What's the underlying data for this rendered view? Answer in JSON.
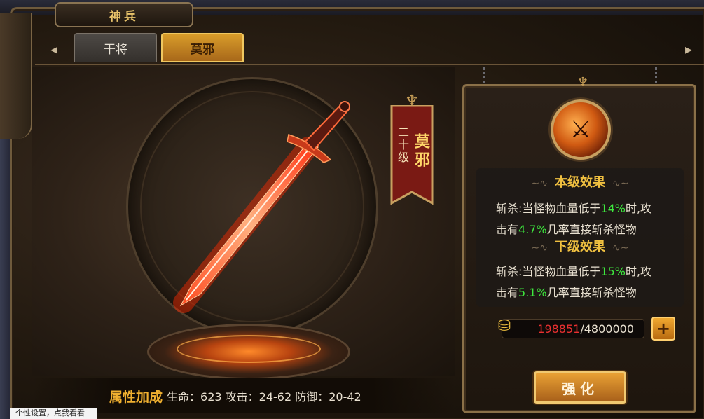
{
  "window": {
    "title": "神兵"
  },
  "tabs": [
    {
      "label": "干将",
      "active": false
    },
    {
      "label": "莫邪",
      "active": true
    }
  ],
  "weapon": {
    "level_text": "二十级",
    "name": "莫邪"
  },
  "attributes": {
    "title": "属性加成",
    "values_text": "生命：623 攻击：24-62 防御：20-42"
  },
  "current_effect": {
    "title": "本级效果",
    "line1_prefix": "斩杀:当怪物血量低于",
    "line1_value": "14%",
    "line1_suffix": "时,攻",
    "line2_prefix": "击有",
    "line2_value": "4.7%",
    "line2_suffix": "几率直接斩杀怪物"
  },
  "next_effect": {
    "title": "下级效果",
    "line1_prefix": "斩杀:当怪物血量低于",
    "line1_value": "15%",
    "line1_suffix": "时,攻",
    "line2_prefix": "击有",
    "line2_value": "5.1%",
    "line2_suffix": "几率直接斩杀怪物"
  },
  "cost": {
    "current": "198851",
    "separator": "/",
    "required": "4800000"
  },
  "buttons": {
    "plus": "+",
    "upgrade": "强化"
  },
  "icons": {
    "nav_left": "◂",
    "nav_right": "▸",
    "crest": "♆",
    "coin": "⛁",
    "skill": "⚔"
  },
  "tooltip": {
    "text": "个性设置，点我看看"
  },
  "colors": {
    "highlight": "#3ee83e",
    "cost_current": "#e83030",
    "title_gold": "#f0c040"
  }
}
